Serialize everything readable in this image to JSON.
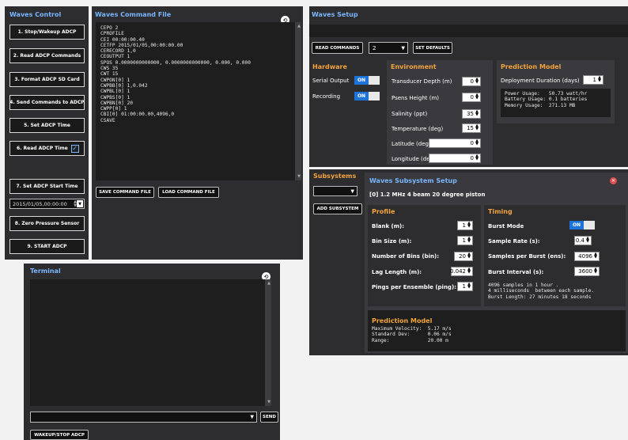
{
  "waves_control": {
    "title": "Waves Control",
    "buttons": [
      "1. Stop/Wakeup ADCP",
      "2. Read ADCP Commands",
      "3. Format ADCP SD Card",
      "4. Send Commands to ADCP",
      "5. Set ADCP Time",
      "6. Read ADCP Time",
      "7. Set ADCP Start Time",
      "8. Zero Pressure Sensor",
      "9. START ADCP"
    ],
    "start_time_value": "2015/01/05,00:00:00",
    "read_time_checked": true
  },
  "command_file": {
    "title": "Waves Command File",
    "lines": [
      "CEPO 2",
      "CPROFILE",
      "CEI 00:00:00.40",
      "CETFP 2015/01/05,00:00:00.00",
      "CERECORD 1,0",
      "CEOUTPUT 1",
      "SPOS 0.0000000000000, 0.0000000000000, 0.000, 0.000",
      "CWS 35",
      "CWT 15",
      "CWPON[0] 1",
      "CWPBB[0] 1,0.042",
      "CWPBL[0] 1",
      "CWPBS[0] 1",
      "CWPBN[0] 20",
      "CWPP[0] 1",
      "CBI[0] 01:00:00.00,4096,0",
      "CSAVE"
    ],
    "save_label": "SAVE COMMAND FILE",
    "load_label": "LOAD COMMAND FILE"
  },
  "terminal": {
    "title": "Terminal",
    "send_label": "SEND",
    "wakeup_label": "WAKEUP/STOP ADCP",
    "input_value": ""
  },
  "waves_setup": {
    "title": "Waves Setup",
    "read_commands_label": "READ COMMANDS",
    "subsystem_count": "2",
    "set_defaults_label": "SET DEFAULTS",
    "hardware": {
      "title": "Hardware",
      "serial_output_label": "Serial Output",
      "recording_label": "Recording",
      "on_label": "ON"
    },
    "environment": {
      "title": "Environment",
      "fields": [
        {
          "label": "Transducer Depth (m)",
          "value": "0"
        },
        {
          "label": "Psens Height (m)",
          "value": "0"
        },
        {
          "label": "Salinity (ppt)",
          "value": "35"
        },
        {
          "label": "Temperature (deg)",
          "value": "15"
        },
        {
          "label": "Latitude (deg)",
          "value": "0"
        },
        {
          "label": "Longitude (deg)",
          "value": "0"
        }
      ]
    },
    "prediction": {
      "title": "Prediction Model",
      "duration_label": "Deployment Duration (days)",
      "duration_value": "1",
      "output": "Power Usage:   50.73 watt/hr\nBattery Usage: 0.1 batteries\nMemory Usage:  271.13 MB"
    }
  },
  "subsystems": {
    "title": "Subsystems",
    "add_label": "ADD SUBSYSTEM",
    "setup_title": "Waves Subsystem Setup",
    "subsystem_name": "[0] 1.2 MHz 4 beam 20 degree piston",
    "profile": {
      "title": "Profile",
      "fields": [
        {
          "label": "Blank (m):",
          "value": "1"
        },
        {
          "label": "Bin Size (m):",
          "value": "1"
        },
        {
          "label": "Number of Bins (bin):",
          "value": "20"
        },
        {
          "label": "Lag Length (m):",
          "value": "0.042"
        },
        {
          "label": "Pings per Ensemble (ping):",
          "value": "1"
        }
      ]
    },
    "timing": {
      "title": "Timing",
      "burst_mode_label": "Burst Mode",
      "on_label": "ON",
      "fields": [
        {
          "label": "Sample Rate (s):",
          "value": "0.4"
        },
        {
          "label": "Samples per Burst (ens):",
          "value": "4096"
        },
        {
          "label": "Burst Interval (s):",
          "value": "3600"
        }
      ],
      "output": "4096 samples in 1 hour .\n4 milliseconds  between each sample.\nBurst Length: 27 minutes 18 seconds"
    },
    "prediction": {
      "title": "Prediction Model",
      "output": "Maximum Velocity:  5.17 m/s\nStandard Dev:      0.06 m/s\nRange:             20.00 m"
    }
  },
  "colors": {
    "accent": "#79b6ff",
    "section": "#f3a43c",
    "toggle": "#1e73d8",
    "close": "#e05050"
  }
}
